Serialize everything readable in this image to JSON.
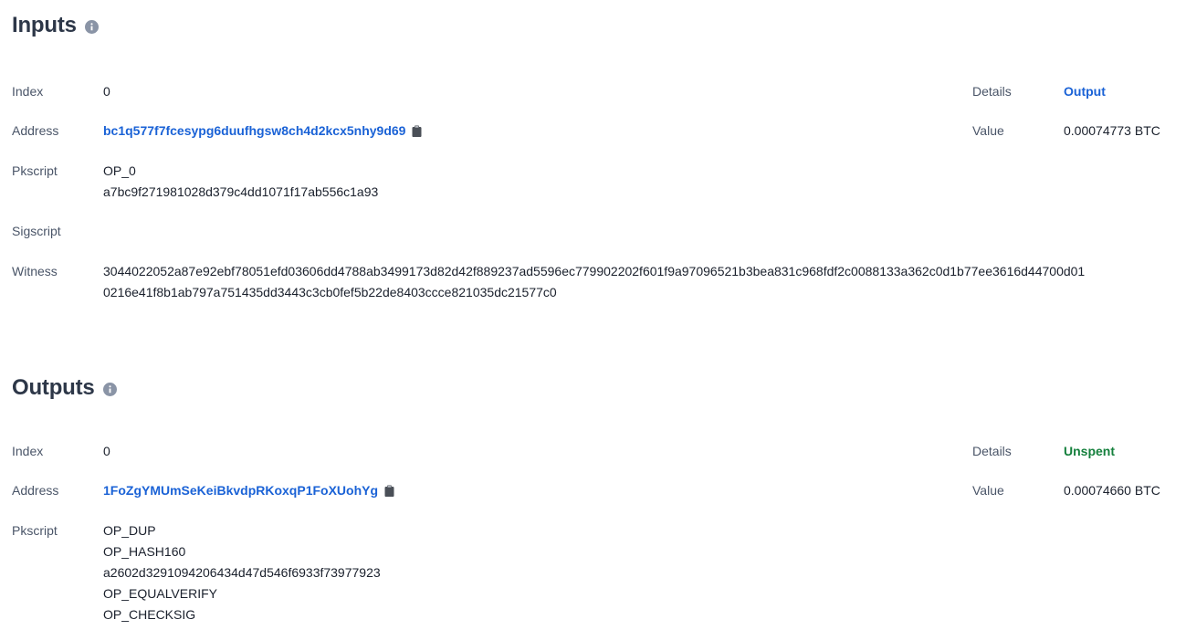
{
  "inputs": {
    "title": "Inputs",
    "labels": {
      "index": "Index",
      "address": "Address",
      "pkscript": "Pkscript",
      "sigscript": "Sigscript",
      "witness": "Witness",
      "details": "Details",
      "value": "Value"
    },
    "index": "0",
    "address": "bc1q577f7fcesypg6duufhgsw8ch4d2kcx5nhy9d69",
    "pkscript": [
      "OP_0",
      "a7bc9f271981028d379c4dd1071f17ab556c1a93"
    ],
    "sigscript": "",
    "witness": [
      "3044022052a87e92ebf78051efd03606dd4788ab3499173d82d42f889237ad5596ec779902202f601f9a97096521b3bea831c968fdf2c0088133a362c0d1b77ee3616d44700d01",
      "0216e41f8b1ab797a751435dd3443c3cb0fef5b22de8403ccce821035dc21577c0"
    ],
    "details": "Output",
    "value": "0.00074773 BTC"
  },
  "outputs": {
    "title": "Outputs",
    "labels": {
      "index": "Index",
      "address": "Address",
      "pkscript": "Pkscript",
      "details": "Details",
      "value": "Value"
    },
    "index": "0",
    "address": "1FoZgYMUmSeKeiBkvdpRKoxqP1FoXUohYg",
    "pkscript": [
      "OP_DUP",
      "OP_HASH160",
      "a2602d3291094206434d47d546f6933f73977923",
      "OP_EQUALVERIFY",
      "OP_CHECKSIG"
    ],
    "details": "Unspent",
    "value": "0.00074660 BTC"
  },
  "colors": {
    "link": "#1a62d6",
    "unspent": "#15803d",
    "heading": "#2d3748",
    "label": "#4a5568"
  },
  "icons": {
    "info": "info-icon",
    "copy": "clipboard-icon"
  }
}
